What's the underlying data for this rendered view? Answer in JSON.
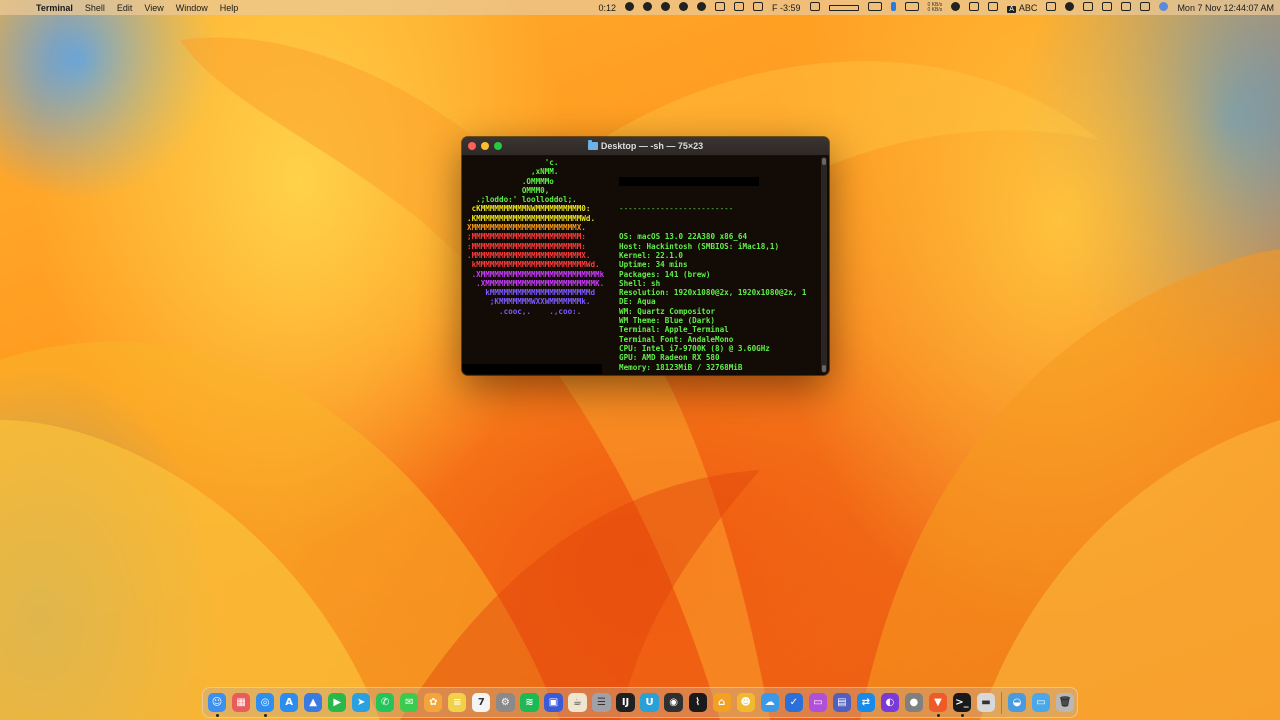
{
  "menubar": {
    "app_name": "Terminal",
    "menus": [
      "Shell",
      "Edit",
      "View",
      "Window",
      "Help"
    ],
    "status": {
      "timer": "0:12",
      "battery_label": "F -3:59",
      "net_up": "0 KB/s",
      "net_down": "0 KB/s",
      "input_letter": "A",
      "input_source": "ABC",
      "datetime": "Mon 7 Nov  12:44:07 AM"
    }
  },
  "terminal": {
    "title": "Desktop — -sh — 75×23",
    "logo_lines": [
      {
        "text": "                 'c.",
        "color": "#5ff04a"
      },
      {
        "text": "              ,xNMM.",
        "color": "#5ff04a"
      },
      {
        "text": "            .OMMMMo",
        "color": "#5ff04a"
      },
      {
        "text": "            OMMM0,",
        "color": "#5ff04a"
      },
      {
        "text": "  .;loddo:' loolloddol;.",
        "color": "#5ff04a"
      },
      {
        "text": " cKMMMMMMMMMMNWMMMMMMMMMM0:",
        "color": "#e8e21a"
      },
      {
        "text": ".KMMMMMMMMMMMMMMMMMMMMMMMWd.",
        "color": "#e8e21a"
      },
      {
        "text": "XMMMMMMMMMMMMMMMMMMMMMMMX.",
        "color": "#f29a1a"
      },
      {
        "text": ";MMMMMMMMMMMMMMMMMMMMMMMM:",
        "color": "#ff3b3b"
      },
      {
        "text": ":MMMMMMMMMMMMMMMMMMMMMMMM:",
        "color": "#ff3b3b"
      },
      {
        "text": ".MMMMMMMMMMMMMMMMMMMMMMMMX.",
        "color": "#ff3b3b"
      },
      {
        "text": " kMMMMMMMMMMMMMMMMMMMMMMMMWd.",
        "color": "#ff3b3b"
      },
      {
        "text": " .XMMMMMMMMMMMMMMMMMMMMMMMMMMk",
        "color": "#c93bff"
      },
      {
        "text": "  .XMMMMMMMMMMMMMMMMMMMMMMMMK.",
        "color": "#c93bff"
      },
      {
        "text": "    kMMMMMMMMMMMMMMMMMMMMMMd",
        "color": "#7a5bff"
      },
      {
        "text": "     ;KMMMMMMMWXXWMMMMMMMk.",
        "color": "#7a5bff"
      },
      {
        "text": "       .cooc,.    .,coo:.",
        "color": "#7a5bff"
      }
    ],
    "separator": "-------------------------",
    "info": [
      {
        "key": "OS",
        "value": "macOS 13.0 22A380 x86_64"
      },
      {
        "key": "Host",
        "value": "Hackintosh (SMBIOS: iMac18,1)"
      },
      {
        "key": "Kernel",
        "value": "22.1.0"
      },
      {
        "key": "Uptime",
        "value": "34 mins"
      },
      {
        "key": "Packages",
        "value": "141 (brew)"
      },
      {
        "key": "Shell",
        "value": "sh"
      },
      {
        "key": "Resolution",
        "value": "1920x1080@2x, 1920x1080@2x, 1"
      },
      {
        "key": "DE",
        "value": "Aqua"
      },
      {
        "key": "WM",
        "value": "Quartz Compositor"
      },
      {
        "key": "WM Theme",
        "value": "Blue (Dark)"
      },
      {
        "key": "Terminal",
        "value": "Apple_Terminal"
      },
      {
        "key": "Terminal Font",
        "value": "AndaleMono"
      },
      {
        "key": "CPU",
        "value": "Intel i7-9700K (8) @ 3.60GHz"
      },
      {
        "key": "GPU",
        "value": "AMD Radeon RX 580"
      },
      {
        "key": "Memory",
        "value": "18123MiB / 32768MiB"
      }
    ],
    "palette_top": [
      "#130b06",
      "#c40000",
      "#00a000",
      "#b0a000",
      "#2b2bd8",
      "#b000b0",
      "#00a8a8",
      "#d0d0d0"
    ],
    "palette_bottom": [
      "#777777",
      "#ff2020",
      "#20e020",
      "#e8e820",
      "#4a4aff",
      "#ff40ff",
      "#30e8e8",
      "#ffffff"
    ]
  },
  "dock": {
    "apps": [
      {
        "name": "finder",
        "color": "#3d8ff0",
        "glyph": "☺",
        "running": true
      },
      {
        "name": "launchpad",
        "color": "#e85c5c",
        "glyph": "▦",
        "running": false
      },
      {
        "name": "safari",
        "color": "#2f8ff0",
        "glyph": "◎",
        "running": true
      },
      {
        "name": "app-store",
        "color": "#2d8cf0",
        "glyph": "A",
        "running": false
      },
      {
        "name": "testflight",
        "color": "#3a7be0",
        "glyph": "▲",
        "running": false
      },
      {
        "name": "facetime",
        "color": "#2bb84a",
        "glyph": "▶",
        "running": false
      },
      {
        "name": "telegram",
        "color": "#2aa0e0",
        "glyph": "➤",
        "running": false
      },
      {
        "name": "whatsapp",
        "color": "#25c45a",
        "glyph": "✆",
        "running": false
      },
      {
        "name": "messages",
        "color": "#3ccb4e",
        "glyph": "✉",
        "running": false
      },
      {
        "name": "photos",
        "color": "#f4a43a",
        "glyph": "✿",
        "running": false
      },
      {
        "name": "notes",
        "color": "#f2d04a",
        "glyph": "≡",
        "running": false
      },
      {
        "name": "calendar",
        "color": "#f4f4f4",
        "glyph": "7",
        "running": false
      },
      {
        "name": "system-settings",
        "color": "#8a8a8a",
        "glyph": "⚙",
        "running": false
      },
      {
        "name": "spotify",
        "color": "#1db954",
        "glyph": "≋",
        "running": false
      },
      {
        "name": "screens",
        "color": "#3a5ad8",
        "glyph": "▣",
        "running": false
      },
      {
        "name": "amphetamine",
        "color": "#f0e6d0",
        "glyph": "☕",
        "running": false
      },
      {
        "name": "database",
        "color": "#a0a0a8",
        "glyph": "☰",
        "running": false
      },
      {
        "name": "intellij",
        "color": "#202020",
        "glyph": "IJ",
        "running": false
      },
      {
        "name": "upwork",
        "color": "#2aa0d8",
        "glyph": "U",
        "running": false
      },
      {
        "name": "record",
        "color": "#303030",
        "glyph": "◉",
        "running": false
      },
      {
        "name": "activity-monitor",
        "color": "#1a1a1a",
        "glyph": "⌇",
        "running": false
      },
      {
        "name": "home",
        "color": "#f4a020",
        "glyph": "⌂",
        "running": false
      },
      {
        "name": "cyberduck",
        "color": "#f2b830",
        "glyph": "☻",
        "running": false
      },
      {
        "name": "cloud",
        "color": "#3a9ae8",
        "glyph": "☁",
        "running": false
      },
      {
        "name": "tasks",
        "color": "#2a70d8",
        "glyph": "✓",
        "running": false
      },
      {
        "name": "tv",
        "color": "#b050d8",
        "glyph": "▭",
        "running": false
      },
      {
        "name": "preview",
        "color": "#5060c0",
        "glyph": "▤",
        "running": false
      },
      {
        "name": "teamviewer",
        "color": "#1a8ae8",
        "glyph": "⇄",
        "running": false
      },
      {
        "name": "github",
        "color": "#7a3ad8",
        "glyph": "◐",
        "running": false
      },
      {
        "name": "utility",
        "color": "#808080",
        "glyph": "●",
        "running": false
      },
      {
        "name": "brave",
        "color": "#f05a28",
        "glyph": "▼",
        "running": true
      },
      {
        "name": "terminal",
        "color": "#1a1a1a",
        "glyph": ">_",
        "running": true
      },
      {
        "name": "system-monitor",
        "color": "#d8d8d8",
        "glyph": "▬",
        "running": false
      }
    ],
    "right": [
      {
        "name": "browser-folder",
        "color": "#4a9ae0",
        "glyph": "◒",
        "running": false
      },
      {
        "name": "downloads-folder",
        "color": "#4aa8e8",
        "glyph": "▭",
        "running": false
      },
      {
        "name": "trash",
        "color": "#b8b8b8",
        "glyph": "🗑",
        "running": false
      }
    ]
  }
}
